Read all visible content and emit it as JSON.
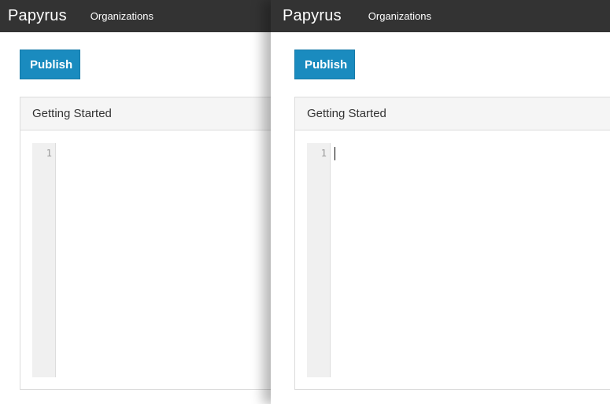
{
  "windows": [
    {
      "navbar": {
        "brand": "Papyrus",
        "links": [
          "Organizations"
        ]
      },
      "toolbar": {
        "publish_label": "Publish"
      },
      "panel": {
        "title": "Getting Started"
      },
      "editor": {
        "line_numbers": [
          "1"
        ],
        "content": ""
      }
    },
    {
      "navbar": {
        "brand": "Papyrus",
        "links": [
          "Organizations"
        ]
      },
      "toolbar": {
        "publish_label": "Publish"
      },
      "panel": {
        "title": "Getting Started"
      },
      "editor": {
        "line_numbers": [
          "1"
        ],
        "content": "",
        "cursor_visible": true
      }
    }
  ],
  "colors": {
    "navbar_bg": "#333333",
    "primary_button": "#1a8bbf",
    "panel_heading_bg": "#f5f5f5"
  }
}
